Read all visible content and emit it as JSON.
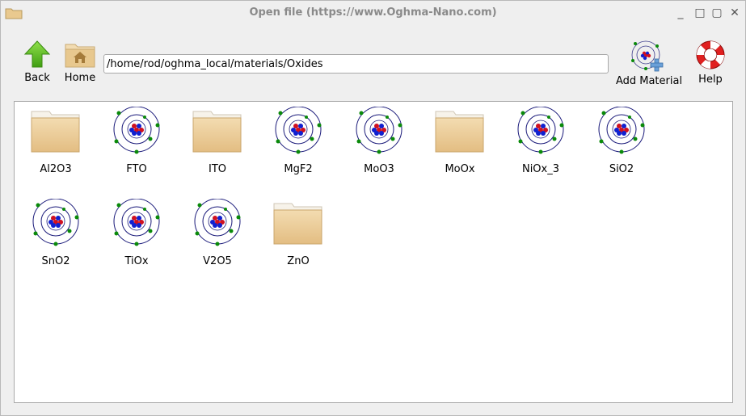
{
  "window": {
    "title": "Open file (https://www.Oghma-Nano.com)",
    "controls": {
      "minimize": "_",
      "restore": "□",
      "close": "✕"
    }
  },
  "toolbar": {
    "back_label": "Back",
    "home_label": "Home",
    "path_value": "/home/rod/oghma_local/materials/Oxides",
    "add_material_label": "Add Material",
    "help_label": "Help"
  },
  "files": [
    {
      "name": "Al2O3",
      "type": "folder"
    },
    {
      "name": "FTO",
      "type": "material"
    },
    {
      "name": "ITO",
      "type": "folder"
    },
    {
      "name": "MgF2",
      "type": "material"
    },
    {
      "name": "MoO3",
      "type": "material"
    },
    {
      "name": "MoOx",
      "type": "folder"
    },
    {
      "name": "NiOx_3",
      "type": "material"
    },
    {
      "name": "SiO2",
      "type": "material"
    },
    {
      "name": "SnO2",
      "type": "material"
    },
    {
      "name": "TiOx",
      "type": "material"
    },
    {
      "name": "V2O5",
      "type": "material"
    },
    {
      "name": "ZnO",
      "type": "folder"
    }
  ],
  "colors": {
    "folder": "#e9c98f",
    "orbit": "#1a1a7a",
    "electron": "#0a8a0a",
    "proton": "#d01020",
    "neutron": "#1020d0",
    "back_arrow": "#5cc21c",
    "help_ring": "#e02020"
  }
}
